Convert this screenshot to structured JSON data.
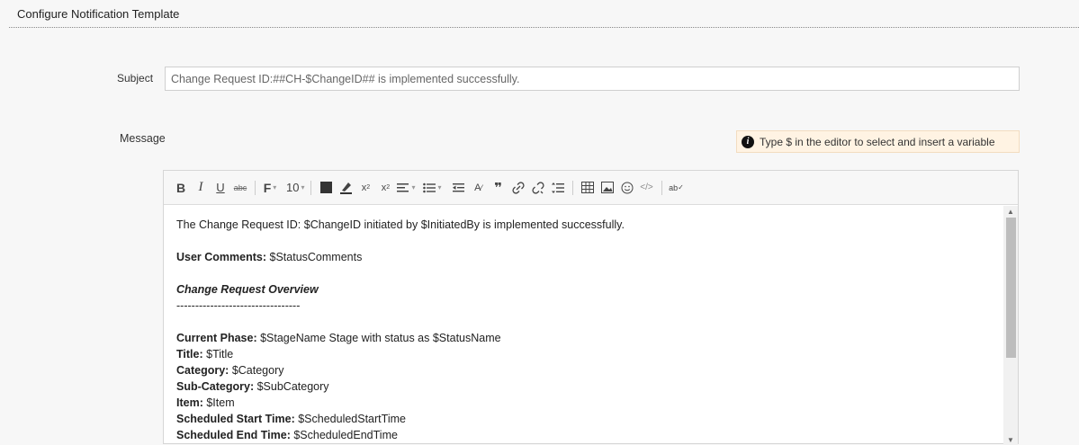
{
  "header": {
    "title": "Configure Notification Template"
  },
  "subject": {
    "label": "Subject",
    "value": "Change Request ID:##CH-$ChangeID## is implemented successfully."
  },
  "message": {
    "label": "Message",
    "hint": "Type $ in the editor to select and insert a variable",
    "hint_icon": "info-icon"
  },
  "toolbar": {
    "font_size": "10",
    "buttons": [
      "bold",
      "italic",
      "underline",
      "strikethrough",
      "font-family",
      "font-size",
      "text-color",
      "background-color",
      "subscript",
      "superscript",
      "align",
      "bullet-list",
      "outdent",
      "format-painter",
      "blockquote",
      "insert-link",
      "remove-link",
      "line-height",
      "table",
      "image",
      "emoji",
      "source-code",
      "spellcheck"
    ]
  },
  "content": {
    "line1": "The Change Request ID: $ChangeID initiated by $InitiatedBy is implemented successfully.",
    "user_comments_label": "User Comments:",
    "user_comments_value": " $StatusComments",
    "overview_title": "Change Request Overview",
    "divider": "---------------------------------",
    "fields": [
      {
        "label": "Current Phase:",
        "value": " $StageName Stage with status as $StatusName"
      },
      {
        "label": "Title:",
        "value": " $Title"
      },
      {
        "label": "Category:",
        "value": " $Category"
      },
      {
        "label": "Sub-Category:",
        "value": " $SubCategory"
      },
      {
        "label": "Item:",
        "value": " $Item"
      },
      {
        "label": "Scheduled Start Time:",
        "value": " $ScheduledStartTime"
      },
      {
        "label": "Scheduled End Time:",
        "value": " $ScheduledEndTime"
      }
    ]
  },
  "colors": {
    "hint_bg": "#fff3e3",
    "page_bg": "#f7f7f7"
  }
}
